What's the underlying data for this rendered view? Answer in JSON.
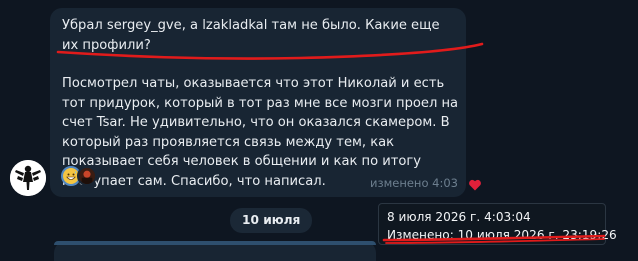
{
  "message": {
    "paragraph1": "Убрал sergey_gve, а lzakladkal там не было. Какие еще их профили?",
    "paragraph2": "Посмотрел чаты, оказывается что этот Николай и есть тот придурок, который в тот раз мне все мозги проел на счет Tsar. Не удивительно, что он оказался скамером. В который раз проявляется связь между тем, как показывает себя человек в общении и как по итогу поступает сам. Спасибо, что написал.",
    "edited_label": "изменено",
    "time": "4:03",
    "reactions": [
      "grinning-face-with-sweat",
      "user-avatar"
    ]
  },
  "date_separator": "10 июля",
  "tooltip": {
    "sent": "8 июля 2026 г. 4:03:04",
    "edited": "Изменено: 10 июля 2026 г. 23:19:26"
  },
  "colors": {
    "background": "#0e1621",
    "bubble": "#182533",
    "annotation_red": "#e11b1b",
    "heart": "#e0203a"
  }
}
